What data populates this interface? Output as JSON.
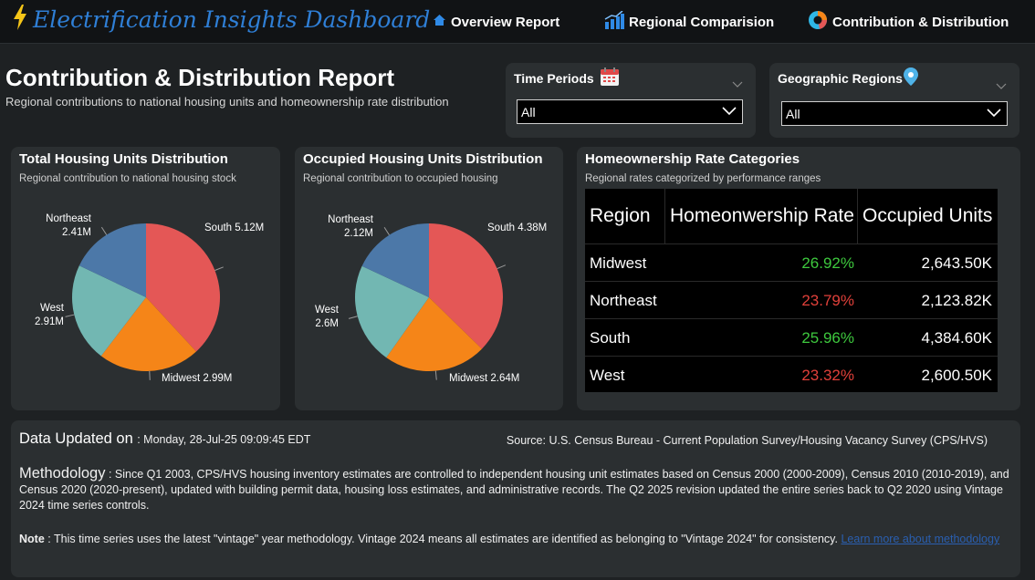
{
  "app": {
    "title": "Electrification Insights Dashboard"
  },
  "nav": {
    "overview": "Overview Report",
    "regional": "Regional Comparision",
    "contribution": "Contribution & Distribution"
  },
  "header": {
    "title": "Contribution & Distribution Report",
    "subtitle": "Regional contributions to national housing units and homeownership rate distribution"
  },
  "filters": {
    "time": {
      "label": "Time Periods",
      "value": "All"
    },
    "region": {
      "label": "Geographic Regions",
      "value": "All"
    }
  },
  "colors": {
    "South": "#e45756",
    "Midwest": "#f58518",
    "West": "#72b7b2",
    "Northeast": "#4c78a8",
    "positive": "#3ec93e",
    "negative": "#e0403a"
  },
  "chart_data": [
    {
      "type": "pie",
      "title": "Total Housing Units Distribution",
      "subtitle": "Regional contribution to national housing stock",
      "categories": [
        "South",
        "Midwest",
        "West",
        "Northeast"
      ],
      "values": [
        5.12,
        2.99,
        2.91,
        2.41
      ],
      "labels": [
        "South 5.12M",
        "Midwest 2.99M",
        "West 2.91M",
        "Northeast 2.41M"
      ]
    },
    {
      "type": "pie",
      "title": "Occupied Housing Units Distribution",
      "subtitle": "Regional contribution to occupied housing",
      "categories": [
        "South",
        "Midwest",
        "West",
        "Northeast"
      ],
      "values": [
        4.38,
        2.64,
        2.6,
        2.12
      ],
      "labels": [
        "South 4.38M",
        "Midwest 2.64M",
        "West 2.6M",
        "Northeast 2.12M"
      ]
    },
    {
      "type": "table",
      "title": "Homeownership Rate Categories",
      "subtitle": "Regional rates categorized by performance ranges",
      "columns": [
        "Region",
        "Homeonwership Rate",
        "Occupied Units"
      ],
      "rows": [
        {
          "region": "Midwest",
          "rate": "26.92%",
          "rate_status": "positive",
          "units": "2,643.50K"
        },
        {
          "region": "Northeast",
          "rate": "23.79%",
          "rate_status": "negative",
          "units": "2,123.82K"
        },
        {
          "region": "South",
          "rate": "25.96%",
          "rate_status": "positive",
          "units": "4,384.60K"
        },
        {
          "region": "West",
          "rate": "23.32%",
          "rate_status": "negative",
          "units": "2,600.50K"
        }
      ]
    }
  ],
  "footer": {
    "updated_label": "Data Updated on",
    "updated_value": ": Monday, 28-Jul-25 09:09:45 EDT",
    "source": "Source: U.S. Census Bureau - Current Population Survey/Housing Vacancy Survey (CPS/HVS)",
    "methodology_label": "Methodology",
    "methodology_text": ": Since Q1 2003, CPS/HVS housing inventory estimates are controlled to independent housing unit estimates based on Census 2000 (2000-2009), Census 2010 (2010-2019), and Census 2020 (2020-present), updated with building permit data, housing loss estimates, and administrative records. The Q2 2025 revision updated the entire series back to Q2 2020 using Vintage 2024 time series controls.",
    "note_label": "Note",
    "note_text": ": This time series uses the latest \"vintage\" year methodology. Vintage 2024 means all estimates are identified as belonging to \"Vintage 2024\" for consistency.",
    "link_text": "Learn more about methodology"
  }
}
